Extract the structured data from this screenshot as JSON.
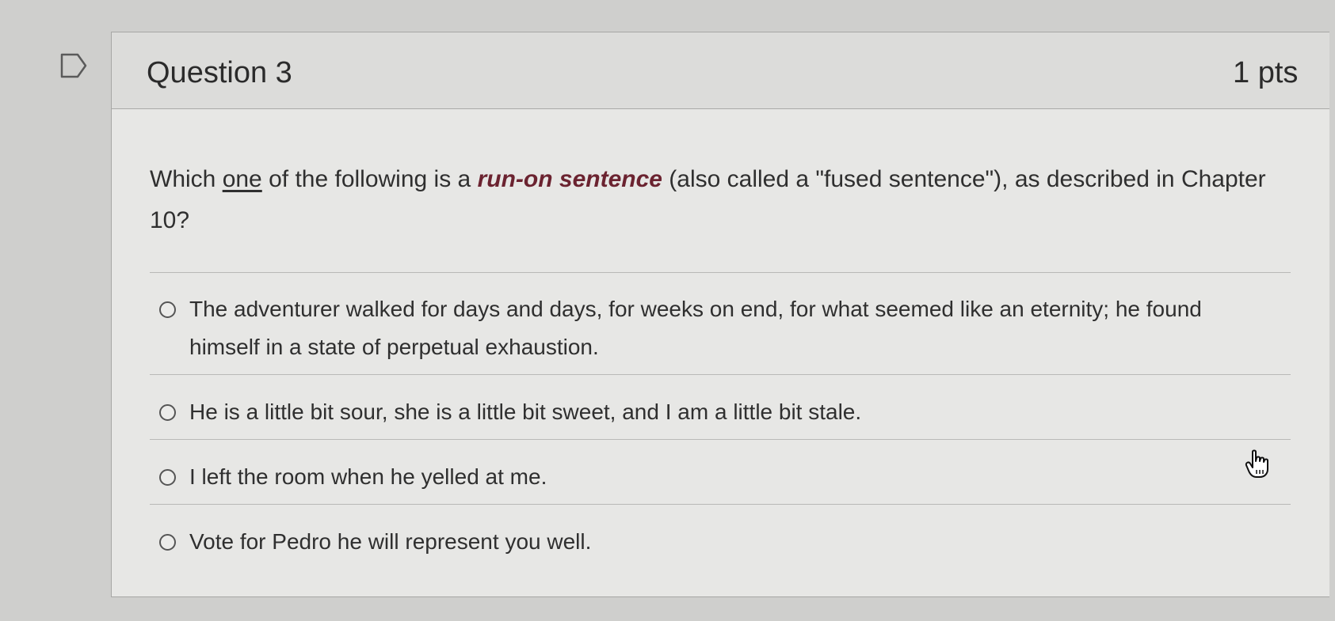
{
  "question": {
    "title": "Question 3",
    "points": "1 pts",
    "prompt_before": "Which ",
    "prompt_underlined": "one",
    "prompt_middle": " of the following is a ",
    "prompt_emphasis": "run-on sentence",
    "prompt_after": " (also called a \"fused sentence\"), as described in Chapter 10?"
  },
  "answers": [
    {
      "label": "The adventurer walked for days and days, for weeks on end, for what seemed like an eternity; he found himself in a state of perpetual exhaustion."
    },
    {
      "label": "He is a little bit sour, she is a little bit sweet, and I am a little bit stale."
    },
    {
      "label": "I left the room when he yelled at me."
    },
    {
      "label": "Vote for Pedro he will represent you well."
    }
  ],
  "icons": {
    "flag": "flag-icon",
    "cursor": "hand-pointer-icon"
  },
  "colors": {
    "emphasis": "#6b2330",
    "card_background": "#e7e7e5",
    "header_background": "#dcdcda"
  }
}
